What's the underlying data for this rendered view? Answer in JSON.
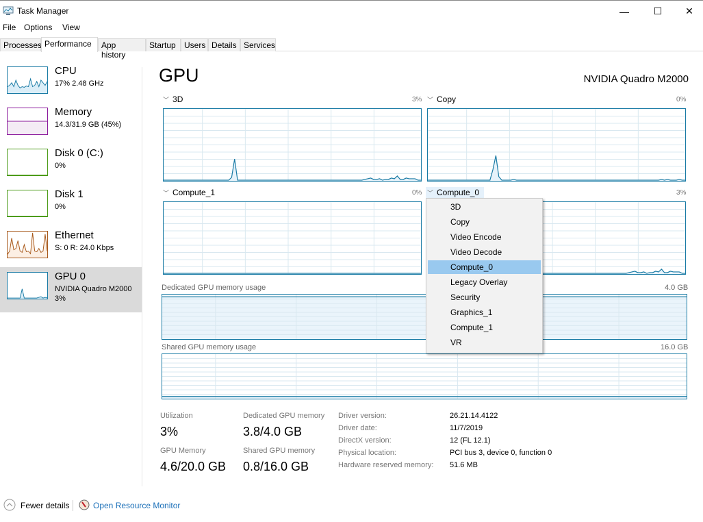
{
  "window": {
    "title": "Task Manager",
    "controls": {
      "minimize": "—",
      "maximize": "☐",
      "close": "✕"
    }
  },
  "menu": [
    "File",
    "Options",
    "View"
  ],
  "tabs": [
    {
      "label": "Processes",
      "active": false
    },
    {
      "label": "Performance",
      "active": true
    },
    {
      "label": "App history",
      "active": false
    },
    {
      "label": "Startup",
      "active": false
    },
    {
      "label": "Users",
      "active": false
    },
    {
      "label": "Details",
      "active": false
    },
    {
      "label": "Services",
      "active": false
    }
  ],
  "sidebar": {
    "items": [
      {
        "name": "CPU",
        "sub": "17%  2.48 GHz",
        "sub2": "",
        "color": "#1a7ba5",
        "fill": "#dbeef8",
        "selected": false
      },
      {
        "name": "Memory",
        "sub": "14.3/31.9 GB (45%)",
        "sub2": "",
        "color": "#8b1a9c",
        "fill": "#f4ecf5",
        "selected": false
      },
      {
        "name": "Disk 0 (C:)",
        "sub": "0%",
        "sub2": "",
        "color": "#4d9c1a",
        "fill": "#eff7e9",
        "selected": false
      },
      {
        "name": "Disk 1",
        "sub": "0%",
        "sub2": "",
        "color": "#4d9c1a",
        "fill": "#eff7e9",
        "selected": false
      },
      {
        "name": "Ethernet",
        "sub": "S: 0 R: 24.0 Kbps",
        "sub2": "",
        "color": "#a7581a",
        "fill": "#fcefe4",
        "selected": false
      },
      {
        "name": "GPU 0",
        "sub": "NVIDIA Quadro M2000",
        "sub2": "3%",
        "color": "#1a7ba5",
        "fill": "#dbeef8",
        "selected": true
      }
    ]
  },
  "main": {
    "title": "GPU",
    "device": "NVIDIA Quadro M2000",
    "engines": [
      {
        "label": "3D",
        "value": "3%"
      },
      {
        "label": "Copy",
        "value": "0%"
      },
      {
        "label": "Compute_1",
        "value": "0%"
      },
      {
        "label": "Compute_0",
        "value": "3%"
      }
    ],
    "dedicated_label": "Dedicated GPU memory usage",
    "dedicated_max": "4.0 GB",
    "shared_label": "Shared GPU memory usage",
    "shared_max": "16.0 GB"
  },
  "dropdown": {
    "items": [
      "3D",
      "Copy",
      "Video Encode",
      "Video Decode",
      "Compute_0",
      "Legacy Overlay",
      "Security",
      "Graphics_1",
      "Compute_1",
      "VR"
    ],
    "selected": "Compute_0"
  },
  "stats": {
    "utilization_label": "Utilization",
    "utilization": "3%",
    "dedicated_label": "Dedicated GPU memory",
    "dedicated": "3.8/4.0 GB",
    "gpu_mem_label": "GPU Memory",
    "gpu_mem": "4.6/20.0 GB",
    "shared_label": "Shared GPU memory",
    "shared": "0.8/16.0 GB"
  },
  "info": [
    {
      "label": "Driver version:",
      "value": "26.21.14.4122"
    },
    {
      "label": "Driver date:",
      "value": "11/7/2019"
    },
    {
      "label": "DirectX version:",
      "value": "12 (FL 12.1)"
    },
    {
      "label": "Physical location:",
      "value": "PCI bus 3, device 0, function 0"
    },
    {
      "label": "Hardware reserved memory:",
      "value": "51.6 MB"
    }
  ],
  "footer": {
    "fewer_details": "Fewer details",
    "resource_monitor": "Open Resource Monitor"
  },
  "series": {
    "3d": [
      0,
      0,
      0,
      0,
      0,
      0,
      0,
      0,
      0,
      0,
      0,
      0,
      0,
      0,
      0,
      0,
      0,
      0,
      0,
      0,
      0,
      0,
      0,
      4,
      30,
      0,
      0,
      0,
      0,
      0,
      0,
      0,
      0,
      0,
      0,
      0,
      0,
      0,
      0,
      0,
      0,
      0,
      0,
      0,
      0,
      0,
      0,
      0,
      0,
      0,
      0,
      0,
      0,
      0,
      0,
      0,
      0,
      0,
      0,
      0,
      0,
      0,
      0,
      0,
      0,
      0,
      0,
      0,
      1,
      2,
      3,
      1,
      1,
      2,
      0,
      1,
      1,
      3,
      2,
      6,
      1,
      1,
      3,
      2,
      2,
      2,
      0,
      0
    ],
    "copy": [
      0,
      0,
      0,
      0,
      0,
      0,
      0,
      0,
      0,
      0,
      0,
      0,
      0,
      0,
      0,
      0,
      0,
      0,
      0,
      0,
      0,
      0,
      15,
      35,
      5,
      0,
      0,
      0,
      0,
      1,
      0,
      0,
      0,
      0,
      0,
      0,
      0,
      0,
      0,
      0,
      0,
      0,
      0,
      0,
      0,
      0,
      0,
      0,
      0,
      0,
      0,
      0,
      0,
      0,
      0,
      0,
      0,
      0,
      0,
      0,
      0,
      0,
      0,
      0,
      0,
      0,
      0,
      0,
      0,
      0,
      0,
      0,
      0,
      0,
      0,
      0,
      0,
      0,
      0,
      1,
      0,
      1,
      0,
      0,
      0,
      1,
      0,
      0
    ],
    "compute0": [
      0,
      0,
      0,
      0,
      0,
      0,
      0,
      0,
      0,
      0,
      0,
      0,
      0,
      0,
      0,
      0,
      0,
      0,
      0,
      0,
      0,
      0,
      0,
      0,
      0,
      0,
      0,
      0,
      0,
      0,
      0,
      0,
      0,
      0,
      0,
      0,
      0,
      0,
      0,
      0,
      0,
      0,
      0,
      0,
      0,
      0,
      0,
      0,
      0,
      0,
      0,
      0,
      0,
      0,
      0,
      0,
      0,
      0,
      0,
      0,
      0,
      0,
      0,
      0,
      0,
      0,
      0,
      0,
      1,
      2,
      3,
      1,
      1,
      2,
      0,
      1,
      1,
      3,
      2,
      6,
      1,
      1,
      3,
      2,
      2,
      2,
      0,
      0
    ],
    "dedicated_gb": 3.8,
    "dedicated_max_gb": 4.0,
    "shared_gb": 0.8,
    "shared_max_gb": 16.0
  }
}
